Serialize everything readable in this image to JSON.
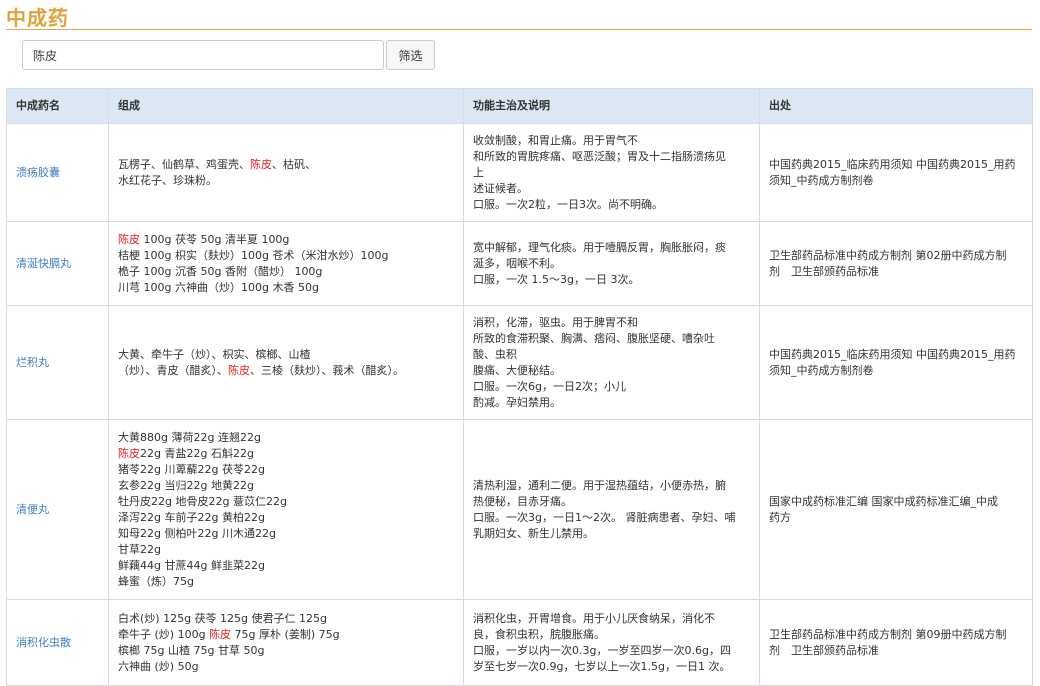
{
  "page": {
    "title": "中成药"
  },
  "search": {
    "value": "陈皮",
    "button_label": "筛选"
  },
  "table": {
    "headers": [
      "中成药名",
      "组成",
      "功能主治及说明",
      "出处"
    ],
    "rows": [
      {
        "name": "溃疡胶囊",
        "composition": [
          [
            {
              "t": "瓦楞子、仙鹤草、鸡蛋壳、"
            },
            {
              "t": "陈皮",
              "hl": true
            },
            {
              "t": "、枯矾、"
            }
          ],
          [
            {
              "t": "水红花子、珍珠粉。"
            }
          ]
        ],
        "function": [
          "收敛制酸，和胃止痛。用于胃气不",
          "和所致的胃脘疼痛、呕恶泛酸；胃及十二指肠溃疡见",
          "上",
          "述证候者。",
          "口服。一次2粒，一日3次。尚不明确。"
        ],
        "source": [
          "中国药典2015_临床药用须知 中国药典2015_用药",
          "须知_中药成方制剂卷"
        ]
      },
      {
        "name": "清涎快膈丸",
        "composition": [
          [
            {
              "t": "陈皮",
              "hl": true
            },
            {
              "t": " 100g 茯苓 50g 清半夏 100g"
            }
          ],
          [
            {
              "t": "桔梗 100g 枳实（麸炒）100g 苍术（米泔水炒）100g"
            }
          ],
          [
            {
              "t": "桅子 100g 沉香 50g 香附（醋炒） 100g"
            }
          ],
          [
            {
              "t": "川芎 100g 六神曲（炒）100g 木香 50g"
            }
          ]
        ],
        "function": [
          "宽中解郁，理气化痰。用于噎膈反胃，胸胀胀闷，痰",
          "涎多，咽喉不利。",
          "口服，一次 1.5～3g，一日 3次。"
        ],
        "source": [
          "卫生部药品标准中药成方制剂 第02册中药成方制",
          "剂　卫生部颁药品标准"
        ]
      },
      {
        "name": "烂积丸",
        "composition": [
          [
            {
              "t": "大黄、牵牛子（炒）、枳实、槟榔、山楂"
            }
          ],
          [
            {
              "t": "（炒）、青皮（醋炙）、"
            },
            {
              "t": "陈皮",
              "hl": true
            },
            {
              "t": "、三棱（麸炒）、莪术（醋炙）。"
            }
          ]
        ],
        "function": [
          "消积，化滞，驱虫。用于脾胃不和",
          "所致的食滞积聚、胸满、痞闷、腹胀坚硬、嘈杂吐",
          "酸、虫积",
          "腹痛、大便秘结。",
          "口服。一次6g，一日2次；小儿",
          "酌减。孕妇禁用。"
        ],
        "source": [
          "中国药典2015_临床药用须知 中国药典2015_用药",
          "须知_中药成方制剂卷"
        ]
      },
      {
        "name": "清便丸",
        "composition": [
          [
            {
              "t": "大黄880g 薄荷22g 连翘22g"
            }
          ],
          [
            {
              "t": "陈皮",
              "hl": true
            },
            {
              "t": "22g 青盐22g 石斛22g"
            }
          ],
          [
            {
              "t": "猪苓22g 川萆薢22g 茯苓22g"
            }
          ],
          [
            {
              "t": "玄参22g 当归22g 地黄22g"
            }
          ],
          [
            {
              "t": "牡丹皮22g 地骨皮22g 薏苡仁22g"
            }
          ],
          [
            {
              "t": "泽泻22g 车前子22g 黄柏22g"
            }
          ],
          [
            {
              "t": "知母22g 侧柏叶22g 川木通22g"
            }
          ],
          [
            {
              "t": "甘草22g"
            }
          ],
          [
            {
              "t": "鲜藕44g 甘蔗44g 鲜韭菜22g"
            }
          ],
          [
            {
              "t": "蜂蜜（炼）75g"
            }
          ]
        ],
        "function": [
          "清热利湿，通利二便。用于湿热蕴结，小便赤热，腑",
          "热便秘，目赤牙痛。",
          "口服。一次3g，一日1～2次。 肾脏病患者、孕妇、哺",
          "乳期妇女、新生儿禁用。"
        ],
        "source": [
          "国家中成药标准汇编 国家中成药标准汇编_中成",
          "药方"
        ]
      },
      {
        "name": "消积化虫散",
        "composition": [
          [
            {
              "t": "白术(炒) 125g 茯苓 125g 使君子仁 125g"
            }
          ],
          [
            {
              "t": "牵牛子 (炒) 100g "
            },
            {
              "t": "陈皮",
              "hl": true
            },
            {
              "t": " 75g 厚朴 (姜制) 75g"
            }
          ],
          [
            {
              "t": "槟榔 75g 山楂 75g 甘草 50g"
            }
          ],
          [
            {
              "t": "六神曲 (炒) 50g"
            }
          ]
        ],
        "function": [
          "消积化虫，开胃增食。用于小儿厌食纳呆，消化不",
          "良，食积虫积，脘腹胀痛。",
          "口服，一岁以内一次0.3g，一岁至四岁一次0.6g，四",
          "岁至七岁一次0.9g，七岁以上一次1.5g，一日1 次。"
        ],
        "source": [
          "卫生部药品标准中药成方制剂 第09册中药成方制",
          "剂　卫生部颁药品标准"
        ]
      }
    ]
  }
}
